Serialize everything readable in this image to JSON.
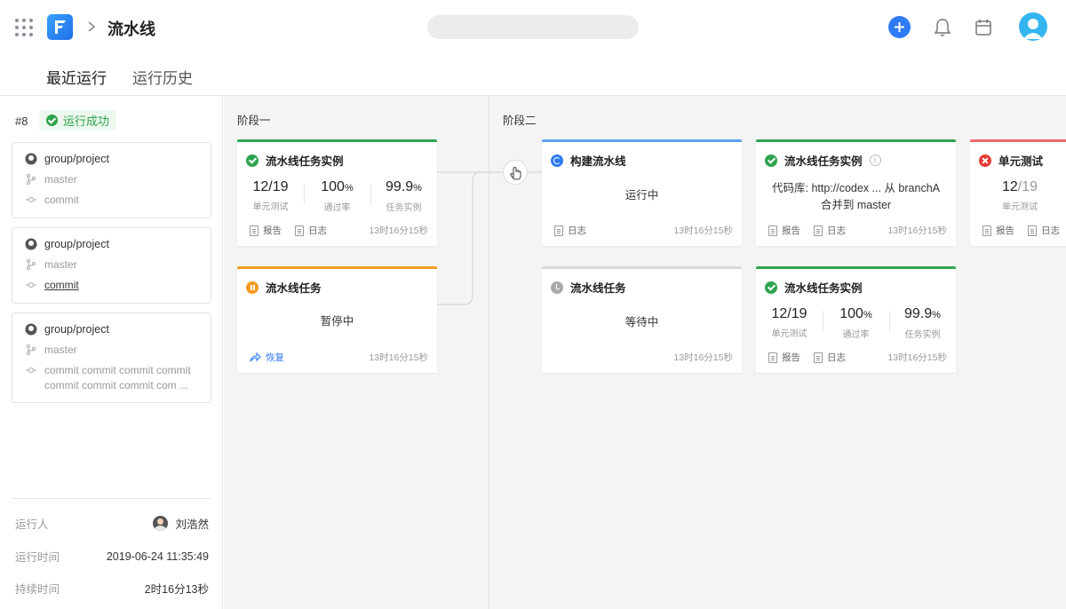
{
  "header": {
    "title": "流水线",
    "search_placeholder": "",
    "tabs": [
      {
        "label": "最近运行",
        "active": true
      },
      {
        "label": "运行历史",
        "active": false
      }
    ]
  },
  "sidebar": {
    "run_number": "#8",
    "run_status": "运行成功",
    "commits": [
      {
        "repo": "group/project",
        "branch": "master",
        "message": "commit"
      },
      {
        "repo": "group/project",
        "branch": "master",
        "message": "commit"
      },
      {
        "repo": "group/project",
        "branch": "master",
        "message_line1": "commit commit commit commit",
        "message_line2": "commit commit commit com ..."
      }
    ],
    "meta": {
      "runner_label": "运行人",
      "runner_value": "刘浩然",
      "time_label": "运行时间",
      "time_value": "2019-06-24 11:35:49",
      "duration_label": "持续时间",
      "duration_value": "2时16分13秒"
    }
  },
  "stages": [
    {
      "label": "阶段一"
    },
    {
      "label": "阶段二"
    }
  ],
  "cards": {
    "s1a": {
      "title": "流水线任务实例",
      "status": "success",
      "stats": [
        {
          "num": "12/19",
          "label": "单元测试"
        },
        {
          "num": "100",
          "unit": "%",
          "label": "通过率"
        },
        {
          "num": "99.9",
          "unit": "%",
          "label": "任务实例"
        }
      ],
      "report": "报告",
      "log": "日志",
      "time": "13时16分15秒"
    },
    "s1b": {
      "title": "流水线任务",
      "status": "paused",
      "body": "暂停中",
      "resume": "恢复",
      "time": "13时16分15秒"
    },
    "s2a": {
      "title": "构建流水线",
      "status": "running",
      "body": "运行中",
      "log": "日志",
      "time": "13时16分15秒"
    },
    "s2b": {
      "title": "流水线任务",
      "status": "waiting",
      "body": "等待中",
      "time": "13时16分15秒"
    },
    "s2c": {
      "title": "流水线任务实例",
      "status": "success",
      "info": "i",
      "body_line1": "代码库: http://codex ... 从 branchA",
      "body_line2": "合并到 master",
      "report": "报告",
      "log": "日志",
      "time": "13时16分15秒"
    },
    "s2d": {
      "title": "流水线任务实例",
      "status": "success",
      "stats": [
        {
          "num": "12/19",
          "label": "单元测试"
        },
        {
          "num": "100",
          "unit": "%",
          "label": "通过率"
        },
        {
          "num": "99.9",
          "unit": "%",
          "label": "任务实例"
        }
      ],
      "report": "报告",
      "log": "日志",
      "time": "13时16分15秒"
    },
    "s2e": {
      "title": "单元测试",
      "status": "failed",
      "stats": [
        {
          "num": "12",
          "num_light": "/19",
          "label": "单元测试"
        }
      ],
      "report": "报告",
      "log": "日志"
    }
  },
  "colors": {
    "success": "#2ea44f",
    "paused": "#f39c1f",
    "running": "#5aa0f2",
    "waiting": "#d9d9d9",
    "failed": "#f06a6a",
    "accent": "#2f7bf5"
  }
}
